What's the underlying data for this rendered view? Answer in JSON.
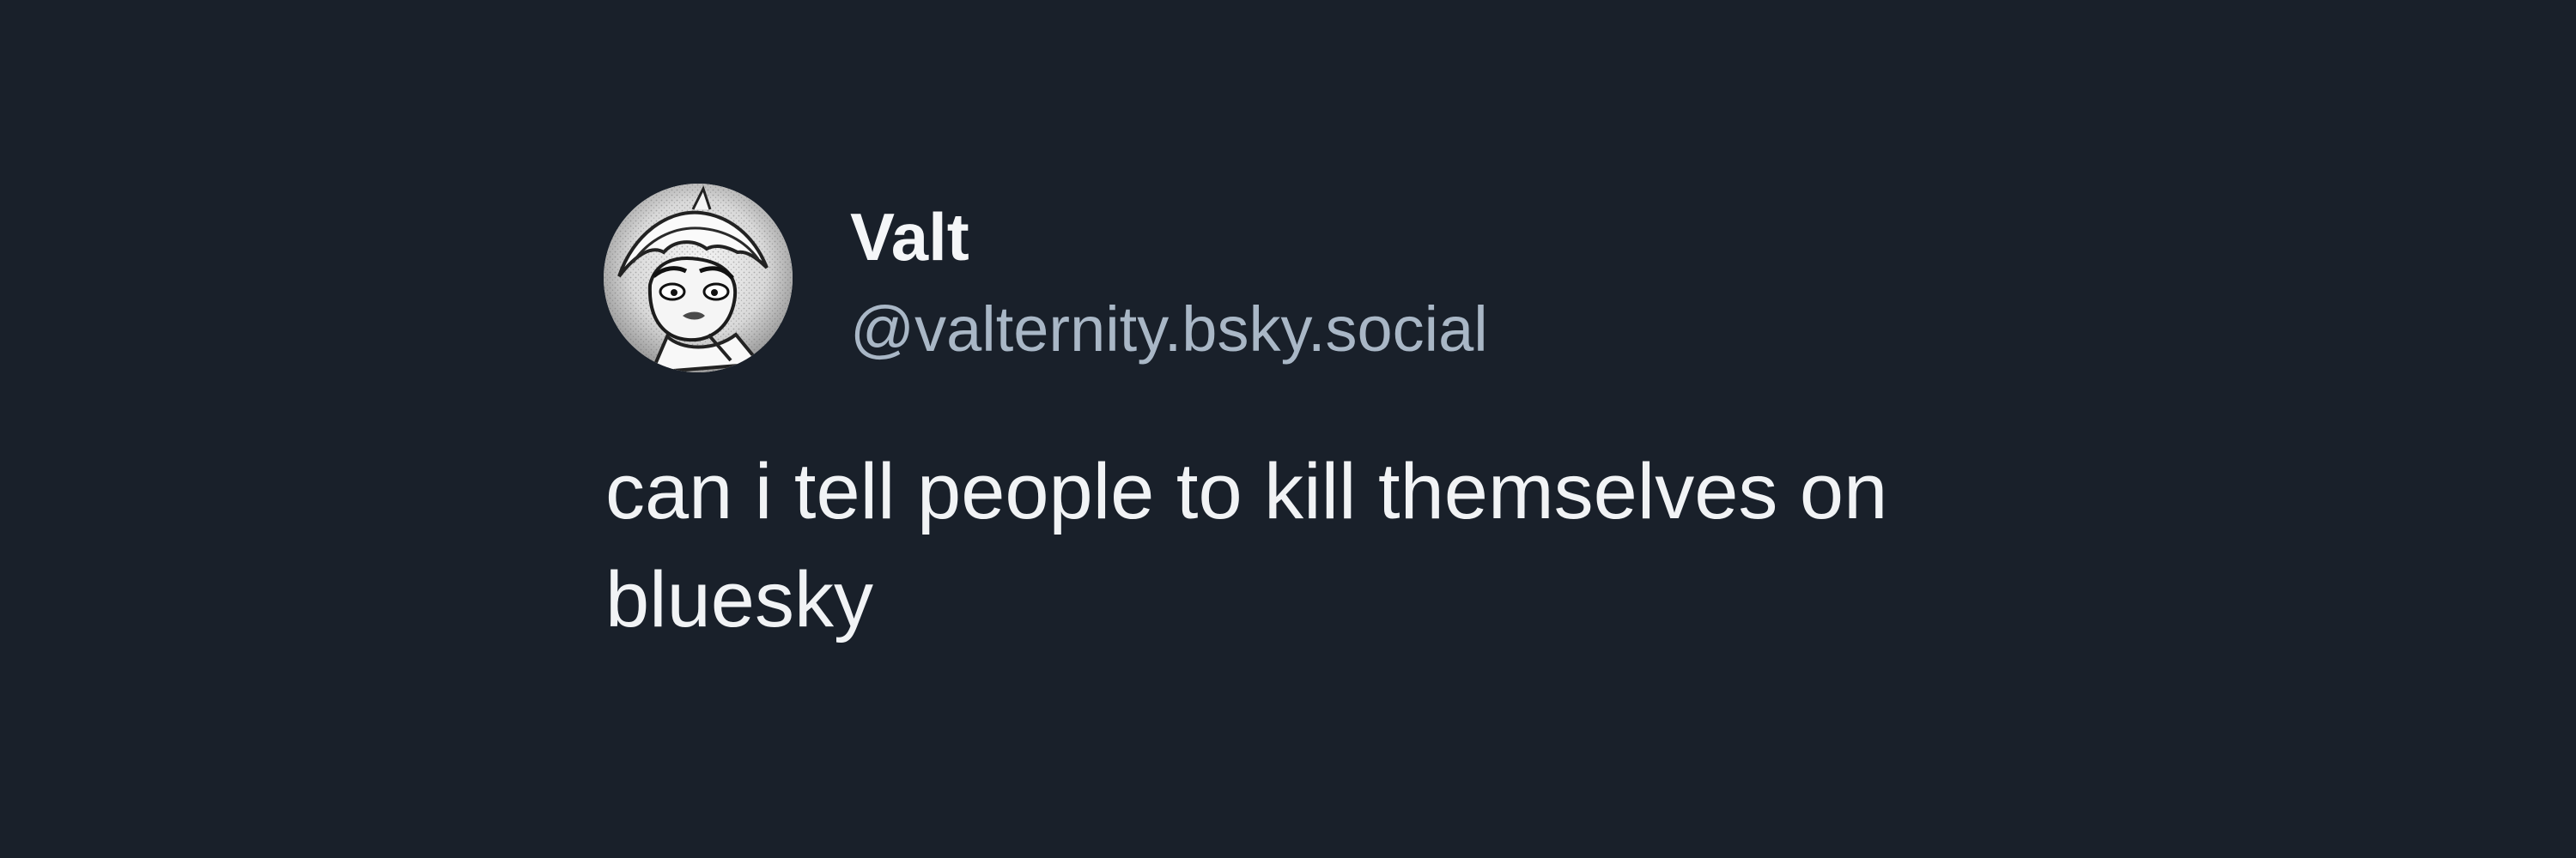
{
  "post": {
    "author": {
      "display_name": "Valt",
      "handle": "@valternity.bsky.social",
      "avatar_icon": "avatar-manga-character"
    },
    "text": "can i tell people to kill themselves on\nbluesky"
  },
  "colors": {
    "background": "#19202a",
    "display_name": "#f4f6f8",
    "handle": "#a9b7c6",
    "post_text": "#f1f3f5"
  }
}
